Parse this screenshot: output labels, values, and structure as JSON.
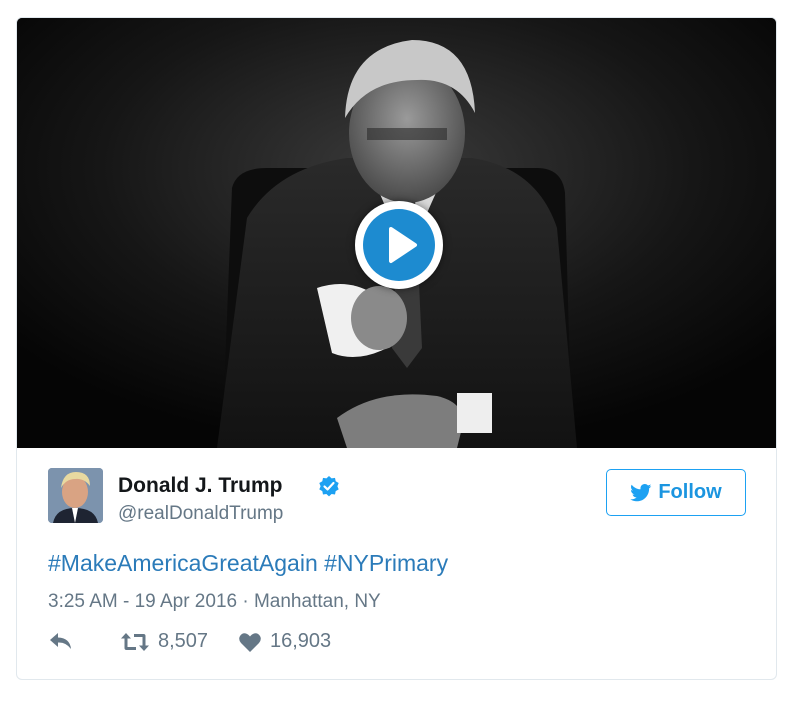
{
  "media": {
    "type": "video",
    "play_icon": "play-icon"
  },
  "user": {
    "name": "Donald J. Trump",
    "handle": "@realDonaldTrump",
    "verified_icon": "verified-badge-icon",
    "avatar": "avatar"
  },
  "follow_button": {
    "label": "Follow",
    "icon": "twitter-bird-icon"
  },
  "tweet": {
    "hashtags": [
      "#MakeAmericaGreatAgain",
      "#NYPrimary"
    ]
  },
  "meta": {
    "time": "3:25 AM - 19 Apr 2016",
    "separator": " · ",
    "location": "Manhattan, NY"
  },
  "actions": {
    "reply_icon": "reply-icon",
    "retweet_icon": "retweet-icon",
    "retweet_count": "8,507",
    "like_icon": "heart-icon",
    "like_count": "16,903"
  },
  "colors": {
    "accent": "#1da1f2",
    "link": "#2b7bb9",
    "muted": "#657786",
    "play_blue": "#1d8bd0",
    "verified": "#1da1f2"
  }
}
